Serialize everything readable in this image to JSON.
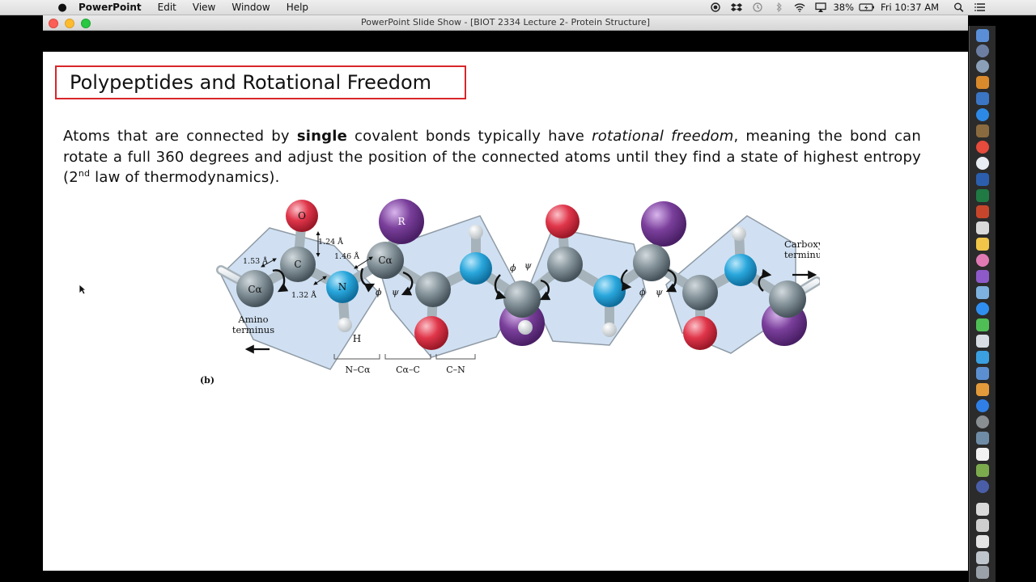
{
  "menubar": {
    "app_name": "PowerPoint",
    "menus": [
      "Edit",
      "View",
      "Window",
      "Help"
    ],
    "battery": "38%",
    "clock": "Fri 10:37 AM"
  },
  "window": {
    "title": "PowerPoint Slide Show - [BIOT 2334 Lecture 2- Protein Structure]"
  },
  "slide": {
    "title": "Polypeptides and Rotational Freedom",
    "body_1": "Atoms that are connected by ",
    "body_bold": "single",
    "body_2": " covalent bonds typically have ",
    "body_italic": "rotational freedom",
    "body_3": ", meaning the bond can rotate a full 360 degrees and adjust the position of the connected atoms until they find a state of highest entropy (2",
    "body_sup": "nd",
    "body_4": " law of thermodynamics)."
  },
  "figure": {
    "atom_O": "O",
    "atom_R": "R",
    "atom_C": "C",
    "atom_N": "N",
    "atom_H": "H",
    "atom_Ca": "Cα",
    "bond_124": "1.24 Å",
    "bond_153": "1.53 Å",
    "bond_146": "1.46 Å",
    "bond_132": "1.32 Å",
    "phi": "ϕ",
    "psi": "ψ",
    "amino_1": "Amino",
    "amino_2": "terminus",
    "carboxyl_1": "Carboxyl",
    "carboxyl_2": "terminus",
    "bracket_1": "N–Cα",
    "bracket_2": "Cα–C",
    "bracket_3": "C–N",
    "panel_label": "(b)"
  },
  "colors": {
    "title_border": "#d9262a",
    "oxygen": "#e0364a",
    "nitrogen": "#2aa7dc",
    "r_group": "#7a3f9b",
    "carbon": "#7d8a91",
    "plane": "#c8daf0"
  }
}
